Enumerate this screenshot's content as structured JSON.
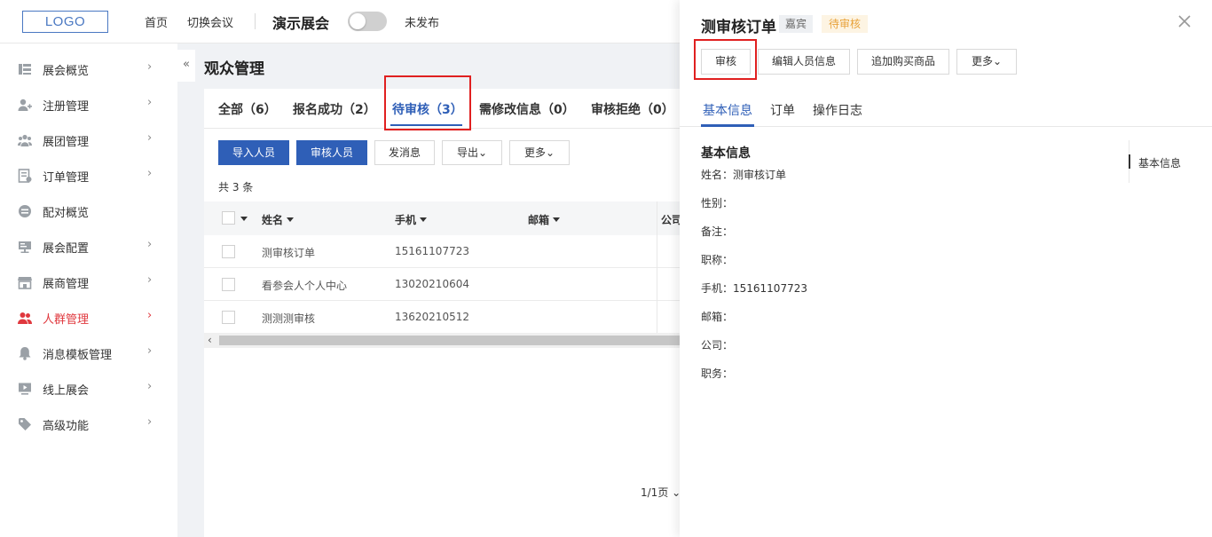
{
  "header": {
    "logo": "LOGO",
    "nav": [
      "首页",
      "切换会议"
    ],
    "expo_name": "演示展会",
    "publish_status": "未发布"
  },
  "sidebar": {
    "collapse": "«",
    "items": [
      {
        "label": "展会概览",
        "icon": "overview-icon",
        "chevron": true,
        "active": false
      },
      {
        "label": "注册管理",
        "icon": "user-add-icon",
        "chevron": true,
        "active": false
      },
      {
        "label": "展团管理",
        "icon": "group-icon",
        "chevron": true,
        "active": false
      },
      {
        "label": "订单管理",
        "icon": "order-icon",
        "chevron": true,
        "active": false
      },
      {
        "label": "配对概览",
        "icon": "match-icon",
        "chevron": false,
        "active": false
      },
      {
        "label": "展会配置",
        "icon": "config-icon",
        "chevron": true,
        "active": false
      },
      {
        "label": "展商管理",
        "icon": "store-icon",
        "chevron": true,
        "active": false
      },
      {
        "label": "人群管理",
        "icon": "people-icon",
        "chevron": true,
        "active": true
      },
      {
        "label": "消息模板管理",
        "icon": "bell-icon",
        "chevron": true,
        "active": false
      },
      {
        "label": "线上展会",
        "icon": "screen-icon",
        "chevron": true,
        "active": false
      },
      {
        "label": "高级功能",
        "icon": "tag-icon",
        "chevron": true,
        "active": false
      }
    ],
    "active_color": "#e0383e"
  },
  "main": {
    "title": "观众管理",
    "tabs": [
      "全部（6）",
      "报名成功（2）",
      "待审核（3）",
      "需修改信息（0）",
      "审核拒绝（0）"
    ],
    "active_tab": "待审核（3）",
    "buttons": {
      "import": "导入人员",
      "review": "审核人员",
      "message": "发消息",
      "export": "导出",
      "more": "更多"
    },
    "count_text": "共 3 条",
    "columns": [
      "姓名",
      "手机",
      "邮箱",
      "公司"
    ],
    "rows": [
      {
        "name": "测审核订单",
        "phone": "15161107723"
      },
      {
        "name": "看参会人个人中心",
        "phone": "13020210604"
      },
      {
        "name": "测测测审核",
        "phone": "13620210512"
      }
    ],
    "pager": "1/1页"
  },
  "drawer": {
    "title": "测审核订单",
    "tag_type": "嘉宾",
    "tag_status": "待审核",
    "buttons": {
      "approve": "审核",
      "edit": "编辑人员信息",
      "add_goods": "追加购买商品",
      "more": "更多"
    },
    "tabs": [
      "基本信息",
      "订单",
      "操作日志"
    ],
    "active_tab": "基本信息",
    "section_title": "基本信息",
    "fields": [
      "姓名：测审核订单",
      "性别：",
      "备注：",
      "职称：",
      "手机：15161107723",
      "邮箱：",
      "公司：",
      "职务："
    ],
    "anchor": "基本信息"
  },
  "colors": {
    "primary": "#2f5fb7",
    "highlight_box": "#e02020",
    "pending_tag": "#e8a23a"
  }
}
